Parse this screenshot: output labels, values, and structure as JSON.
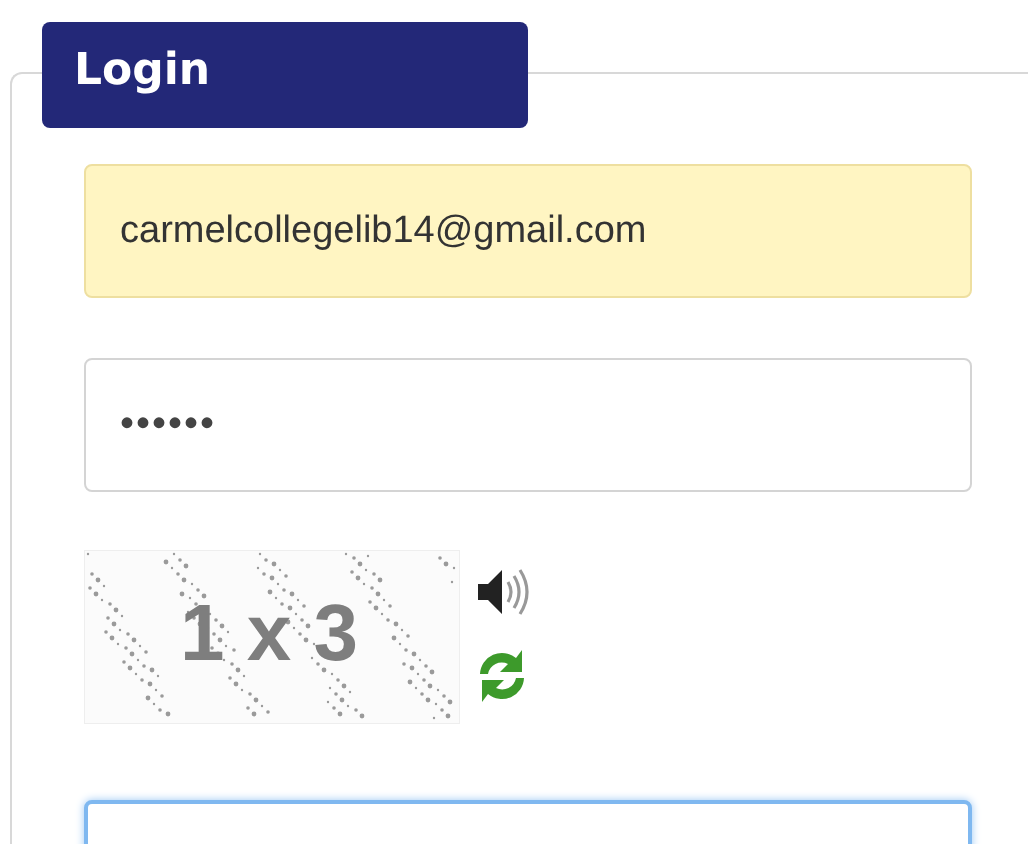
{
  "panel": {
    "title": "Login"
  },
  "email": {
    "value": "carmelcollegelib14@gmail.com",
    "autofilled": true
  },
  "password": {
    "value": "••••••",
    "autofilled": false
  },
  "captcha": {
    "text": "1 x 3"
  },
  "answer": {
    "focused": true
  }
}
